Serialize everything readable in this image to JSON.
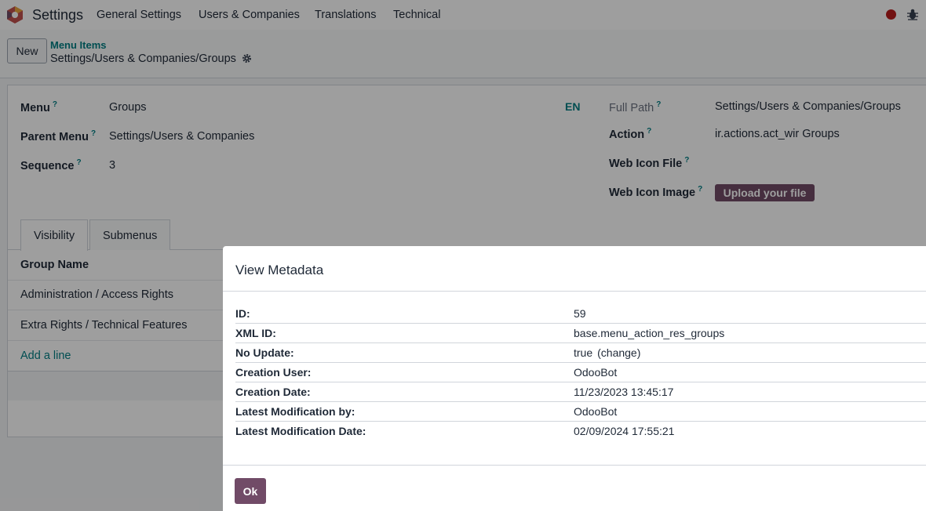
{
  "navbar": {
    "app_icon": "odoo-settings-icon",
    "app_name": "Settings",
    "items": [
      "General Settings",
      "Users & Companies",
      "Translations",
      "Technical"
    ],
    "record_icon": "record-dot-icon",
    "debug_icon": "bug-icon"
  },
  "control": {
    "new_label": "New",
    "breadcrumb_parent": "Menu Items",
    "breadcrumb_current": "Settings/Users & Companies/Groups",
    "gear_icon": "gear-icon"
  },
  "form": {
    "menu_label": "Menu",
    "menu_value": "Groups",
    "lang_tag": "EN",
    "parent_label": "Parent Menu",
    "parent_value": "Settings/Users & Companies",
    "sequence_label": "Sequence",
    "sequence_value": "3",
    "full_path_label": "Full Path",
    "full_path_value": "Settings/Users & Companies/Groups",
    "action_label": "Action",
    "action_value": "ir.actions.act_wir Groups",
    "web_icon_file_label": "Web Icon File",
    "web_icon_image_label": "Web Icon Image",
    "upload_label": "Upload your file",
    "help_mark": "?"
  },
  "tabs": [
    "Visibility",
    "Submenus"
  ],
  "list": {
    "header": "Group Name",
    "rows": [
      "Administration / Access Rights",
      "Extra Rights / Technical Features"
    ],
    "add_line": "Add a line"
  },
  "modal": {
    "title": "View Metadata",
    "rows": [
      {
        "key": "ID:",
        "value": "59"
      },
      {
        "key": "XML ID:",
        "value": "base.menu_action_res_groups"
      },
      {
        "key": "No Update:",
        "value": "true",
        "link": "(change)"
      },
      {
        "key": "Creation User:",
        "value": "OdooBot"
      },
      {
        "key": "Creation Date:",
        "value": "11/23/2023 13:45:17"
      },
      {
        "key": "Latest Modification by:",
        "value": "OdooBot"
      },
      {
        "key": "Latest Modification Date:",
        "value": "02/09/2024 17:55:21"
      }
    ],
    "ok_label": "Ok"
  },
  "colors": {
    "brand": "#714b67",
    "accent": "#017e84"
  }
}
